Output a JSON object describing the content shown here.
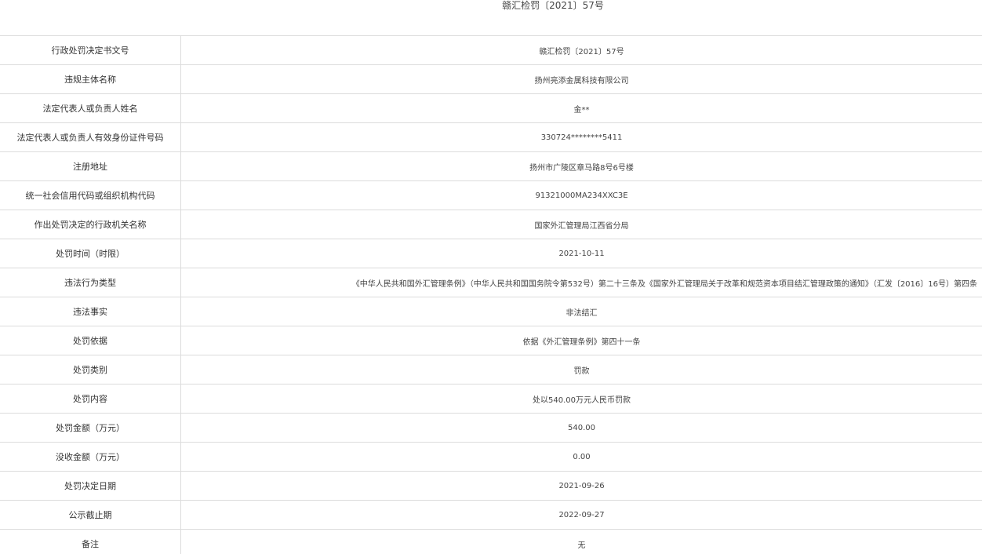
{
  "document": {
    "title": "赣汇检罚〔2021〕57号"
  },
  "rows": [
    {
      "label": "行政处罚决定书文号",
      "value": "赣汇检罚〔2021〕57号"
    },
    {
      "label": "违规主体名称",
      "value": "扬州亮添金属科技有限公司"
    },
    {
      "label": "法定代表人或负责人姓名",
      "value": "金**"
    },
    {
      "label": "法定代表人或负责人有效身份证件号码",
      "value": "330724********5411"
    },
    {
      "label": "注册地址",
      "value": "扬州市广陵区章马路8号6号楼"
    },
    {
      "label": "统一社会信用代码或组织机构代码",
      "value": "91321000MA234XXC3E"
    },
    {
      "label": "作出处罚决定的行政机关名称",
      "value": "国家外汇管理局江西省分局"
    },
    {
      "label": "处罚时间（时限）",
      "value": "2021-10-11"
    },
    {
      "label": "违法行为类型",
      "value": "《中华人民共和国外汇管理条例》（中华人民共和国国务院令第532号）第二十三条及《国家外汇管理局关于改革和规范资本项目结汇管理政策的通知》（汇发〔2016〕16号）第四条"
    },
    {
      "label": "违法事实",
      "value": "非法结汇"
    },
    {
      "label": "处罚依据",
      "value": "依据《外汇管理条例》第四十一条"
    },
    {
      "label": "处罚类别",
      "value": "罚款"
    },
    {
      "label": "处罚内容",
      "value": "处以540.00万元人民币罚款"
    },
    {
      "label": "处罚金额（万元）",
      "value": "540.00"
    },
    {
      "label": "没收金额（万元）",
      "value": "0.00"
    },
    {
      "label": "处罚决定日期",
      "value": "2021-09-26"
    },
    {
      "label": "公示截止期",
      "value": "2022-09-27"
    },
    {
      "label": "备注",
      "value": "无"
    }
  ]
}
